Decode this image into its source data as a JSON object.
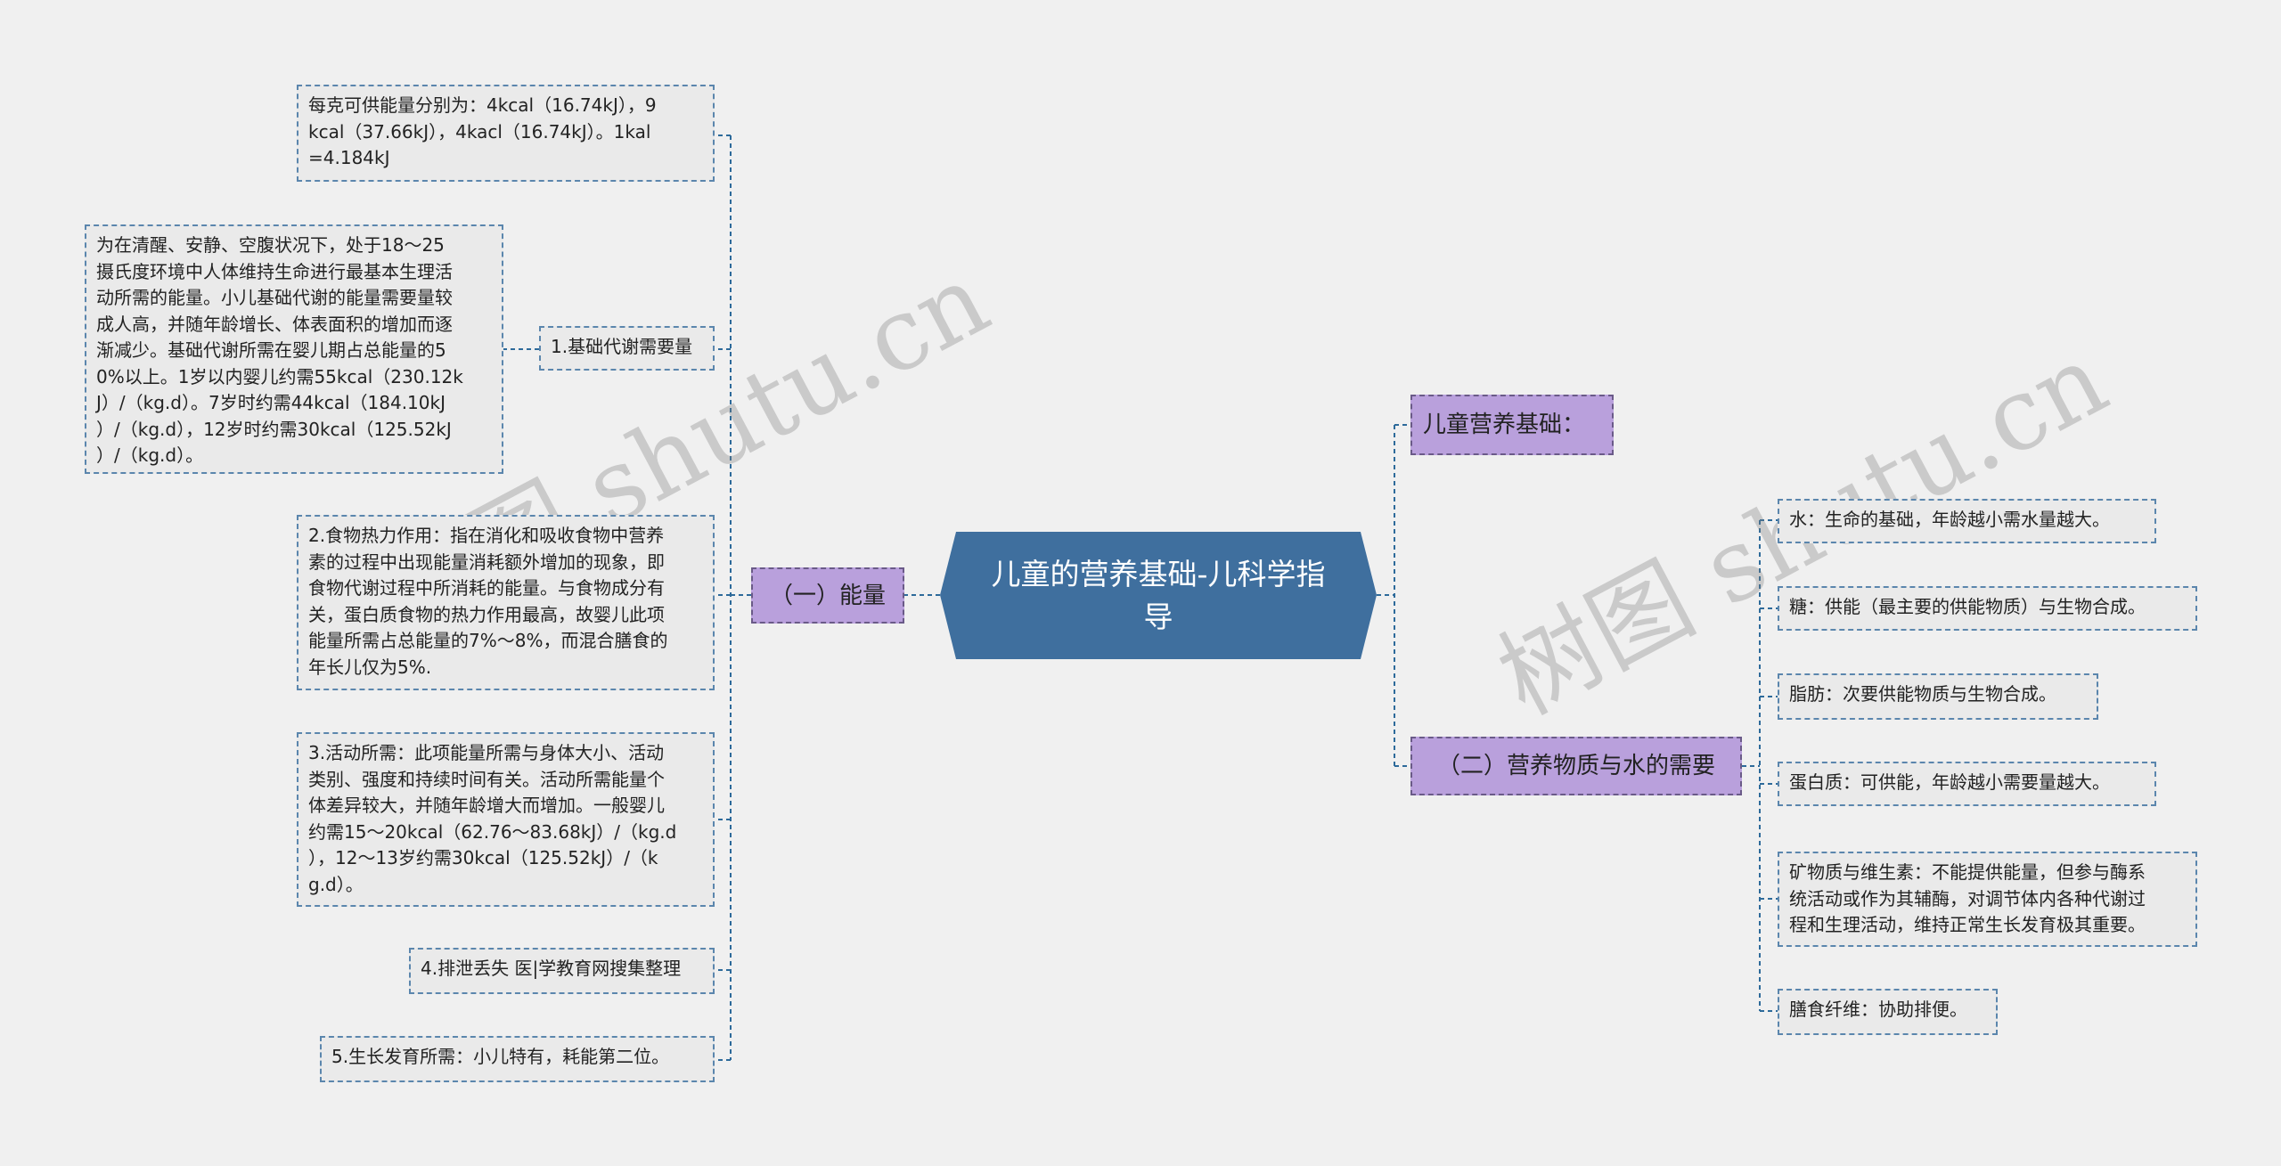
{
  "root": {
    "title": "儿童的营养基础-儿科学指\n导"
  },
  "branches": {
    "basics": "儿童营养基础：",
    "energy": "（一）能量",
    "nutrients": "（二）营养物质与水的需要"
  },
  "energy_items": {
    "unit": "每克可供能量分别为：4kcal（16.74kJ），9\nkcal（37.66kJ），4kacl（16.74kJ）。1kal\n=4.184kJ",
    "bmr_label": "1.基础代谢需要量",
    "bmr_detail": "为在清醒、安静、空腹状况下，处于18～25\n摄氏度环境中人体维持生命进行最基本生理活\n动所需的能量。小儿基础代谢的能量需要量较\n成人高，并随年龄增长、体表面积的增加而逐\n渐减少。基础代谢所需在婴儿期占总能量的5\n0%以上。1岁以内婴儿约需55kcal（230.12k\nJ）/（kg.d）。7岁时约需44kcal（184.10kJ\n）/（kg.d），12岁时约需30kcal（125.52kJ\n）/（kg.d）。",
    "thermic": "2.食物热力作用：指在消化和吸收食物中营养\n素的过程中出现能量消耗额外增加的现象，即\n食物代谢过程中所消耗的能量。与食物成分有\n关，蛋白质食物的热力作用最高，故婴儿此项\n能量所需占总能量的7%～8%，而混合膳食的\n年长儿仅为5%.",
    "activity": "3.活动所需：此项能量所需与身体大小、活动\n类别、强度和持续时间有关。活动所需能量个\n体差异较大，并随年龄增大而增加。一般婴儿\n约需15～20kcal（62.76～83.68kJ）/（kg.d\n），12～13岁约需30kcal（125.52kJ）/（k\ng.d）。",
    "excretion": "4.排泄丢失 医|学教育网搜集整理",
    "growth": "5.生长发育所需：小儿特有，耗能第二位。"
  },
  "nutrient_items": {
    "water": "水：生命的基础，年龄越小需水量越大。",
    "sugar": "糖：供能（最主要的供能物质）与生物合成。",
    "fat": "脂肪：次要供能物质与生物合成。",
    "protein": "蛋白质：可供能，年龄越小需要量越大。",
    "minerals": "矿物质与维生素：不能提供能量，但参与酶系\n统活动或作为其辅酶，对调节体内各种代谢过\n程和生理活动，维持正常生长发育极其重要。",
    "fiber": "膳食纤维：协助排便。"
  },
  "watermarks": {
    "left": "树图 shutu.cn",
    "right": "树图 shutu.cn"
  }
}
